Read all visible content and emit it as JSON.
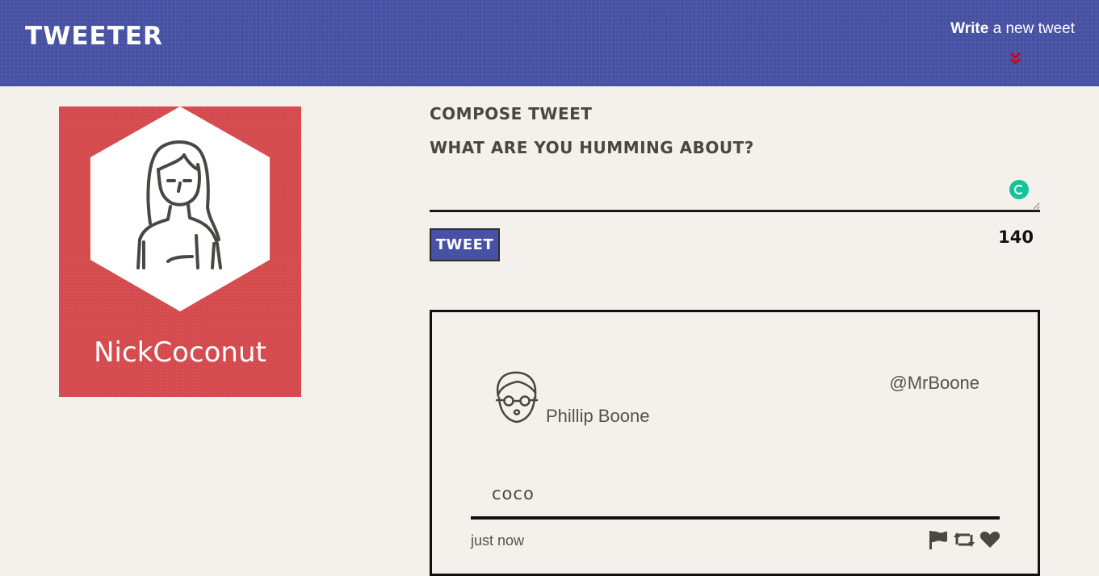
{
  "nav": {
    "brand": "TWEETER",
    "write_bold": "Write",
    "write_rest": " a new tweet",
    "toggle_icon": "double-chevron-down-icon",
    "toggle_color": "#d0021b"
  },
  "profile": {
    "name": "NickCoconut",
    "background_color": "#d44a4d",
    "avatar_icon": "woman-avatar-icon"
  },
  "compose": {
    "title": "Compose Tweet",
    "label": "What are you humming about?",
    "textarea_value": "",
    "submit_label": "Tweet",
    "counter": "140"
  },
  "tweet": {
    "avatar_icon": "man-with-glasses-avatar-icon",
    "name": "Phillip Boone",
    "handle": "@MrBoone",
    "content": "coco",
    "time": "just now",
    "actions": [
      "flag-icon",
      "retweet-icon",
      "heart-icon"
    ]
  },
  "colors": {
    "nav": "#4852a4",
    "page_background": "#f4f1ec",
    "text": "#4a4743"
  }
}
